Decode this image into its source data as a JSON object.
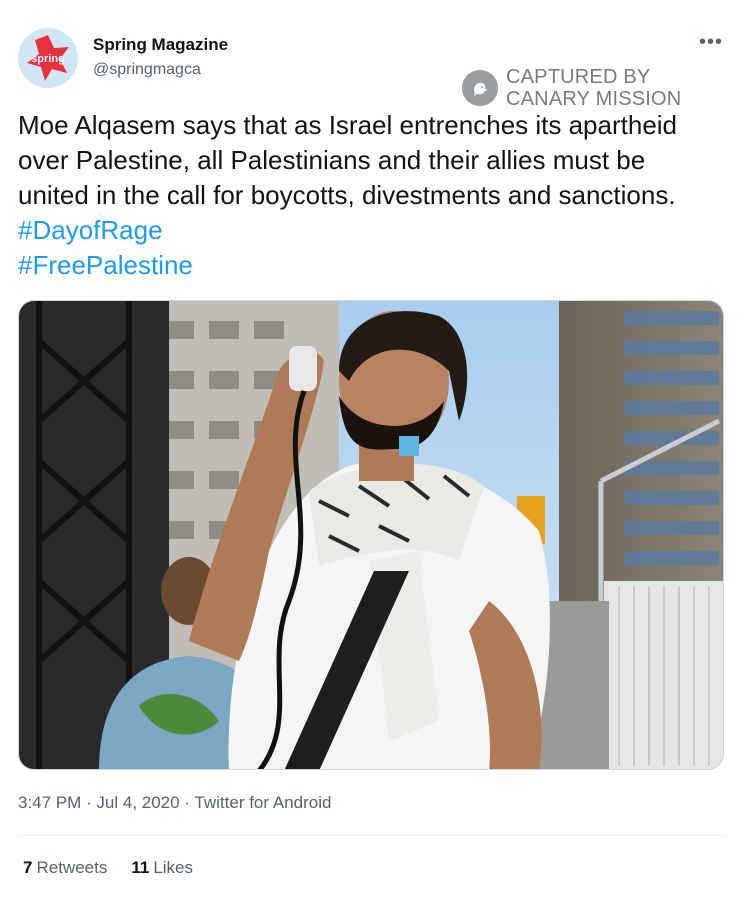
{
  "author": {
    "display_name": "Spring Magazine",
    "handle": "@springmagca",
    "avatar_text": "spring"
  },
  "watermark": {
    "line1": "CAPTURED BY",
    "line2": "CANARY MISSION"
  },
  "tweet": {
    "text": "Moe Alqasem says that as Israel entrenches its apartheid over Palestine, all Palestinians and their allies must be united in the call for boycotts, divestments and sanctions. ",
    "hashtag1": "#DayofRage",
    "hashtag2": "#FreePalestine"
  },
  "meta": {
    "time": "3:47 PM",
    "sep1": " · ",
    "date": "Jul 4, 2020",
    "sep2": " · ",
    "source": "Twitter for Android"
  },
  "stats": {
    "retweets_count": "7",
    "retweets_label": "Retweets",
    "likes_count": "11",
    "likes_label": "Likes"
  },
  "icons": {
    "more": "more-icon",
    "watermark": "canary-bird-icon"
  },
  "colors": {
    "link": "#1d9bf0",
    "avatar_red": "#e8313f",
    "secondary_text": "#536471"
  }
}
